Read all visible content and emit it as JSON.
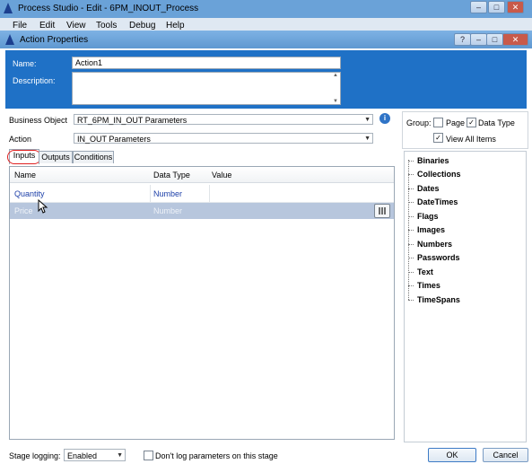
{
  "main_window": {
    "title": "Process Studio  - Edit - 6PM_INOUT_Process",
    "menu": [
      "File",
      "Edit",
      "View",
      "Tools",
      "Debug",
      "Help"
    ]
  },
  "dialog": {
    "title": "Action Properties",
    "name_label": "Name:",
    "name_value": "Action1",
    "description_label": "Description:",
    "description_value": "",
    "business_object_label": "Business Object",
    "business_object_value": "RT_6PM_IN_OUT Parameters",
    "action_label": "Action",
    "action_value": "IN_OUT Parameters",
    "tabs": [
      "Inputs",
      "Outputs",
      "Conditions"
    ],
    "active_tab": "Inputs",
    "grid": {
      "headers": [
        "Name",
        "Data Type",
        "Value"
      ],
      "rows": [
        {
          "name": "Quantity",
          "type": "Number",
          "value": ""
        },
        {
          "name": "Price",
          "type": "Number",
          "value": ""
        }
      ]
    },
    "group": {
      "label": "Group:",
      "page_label": "Page",
      "page_checked": false,
      "data_type_label": "Data Type",
      "data_type_checked": true,
      "view_all_label": "View All Items",
      "view_all_checked": true
    },
    "tree_items": [
      "Binaries",
      "Collections",
      "Dates",
      "DateTimes",
      "Flags",
      "Images",
      "Numbers",
      "Passwords",
      "Text",
      "Times",
      "TimeSpans"
    ],
    "stage_logging_label": "Stage logging:",
    "stage_logging_value": "Enabled",
    "dont_log_label": "Don't log parameters on this stage",
    "ok_label": "OK",
    "cancel_label": "Cancel"
  },
  "colors": {
    "header_blue": "#1f71c6",
    "link_blue": "#1c3fa8",
    "selected_row": "#b7c6dd"
  }
}
